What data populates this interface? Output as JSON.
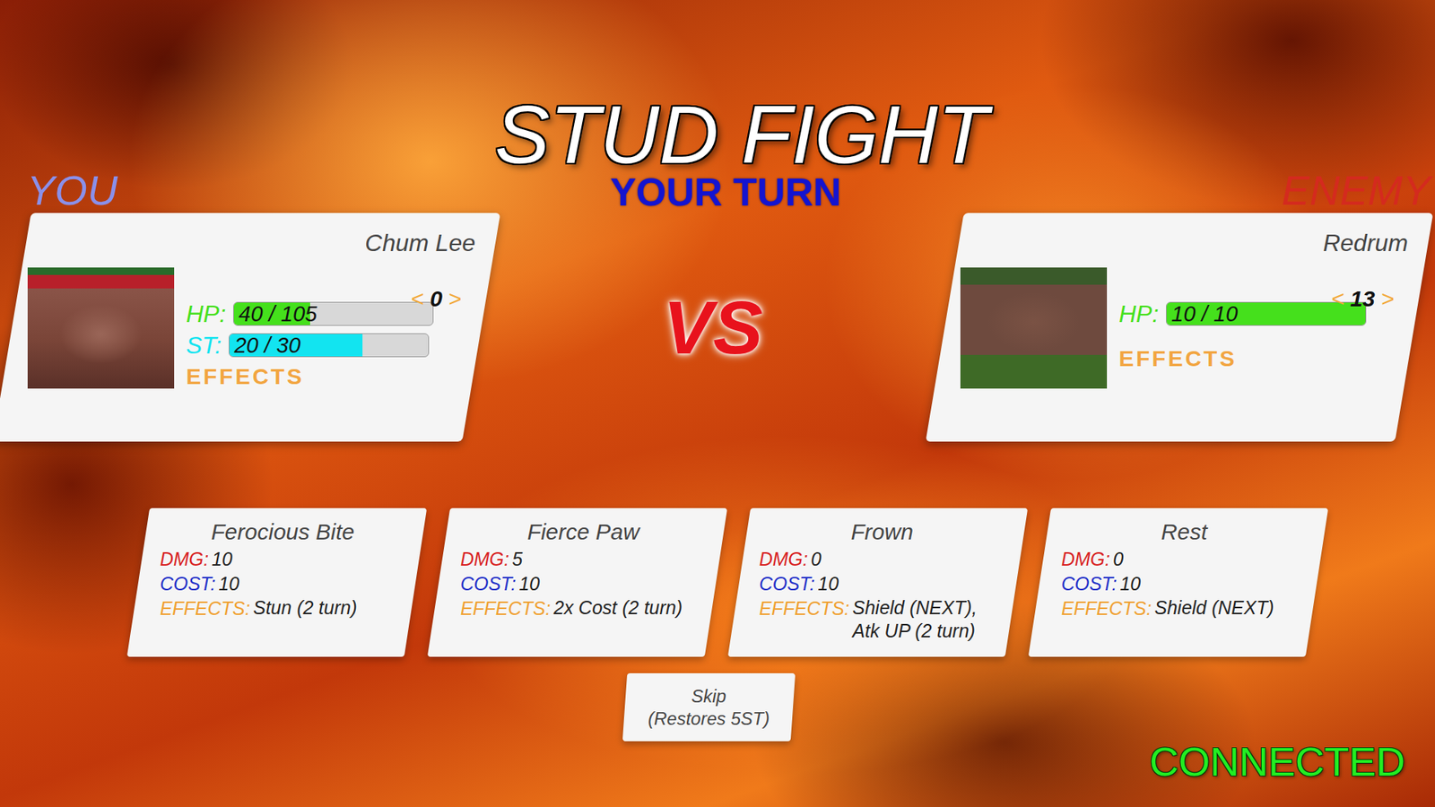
{
  "title": "STUD FIGHT",
  "turn": "YOUR TURN",
  "vs": "VS",
  "fighters": [
    {
      "side_label": "YOU",
      "color": "#8a90ea",
      "name": "Chum Lee",
      "counter": {
        "prev": "<",
        "value": "0",
        "next": ">"
      },
      "stats": [
        {
          "label": "HP:",
          "reading": "40 / 105",
          "level": 0.381,
          "color": "#45e01c"
        },
        {
          "label": "ST:",
          "reading": "20 / 30",
          "level": 0.667,
          "color": "#12e4f0"
        }
      ],
      "effects_label": "EFFECTS"
    },
    {
      "side_label": "ENEMY",
      "color": "#d42a1e",
      "name": "Redrum",
      "counter": {
        "prev": "<",
        "value": "13",
        "next": ">"
      },
      "stats": [
        {
          "label": "HP:",
          "reading": "10 / 10",
          "level": 1,
          "color": "#45e01c"
        }
      ],
      "effects_label": "EFFECTS"
    }
  ],
  "moves": [
    {
      "name": "Ferocious Bite",
      "dmg_label": "DMG:",
      "dmg": "10",
      "cost_label": "COST:",
      "cost": "10",
      "effects_label": "EFFECTS:",
      "effects": [
        "Stun (2 turn)"
      ]
    },
    {
      "name": "Fierce Paw",
      "dmg_label": "DMG:",
      "dmg": "5",
      "cost_label": "COST:",
      "cost": "10",
      "effects_label": "EFFECTS:",
      "effects": [
        "2x Cost (2 turn)"
      ]
    },
    {
      "name": "Frown",
      "dmg_label": "DMG:",
      "dmg": "0",
      "cost_label": "COST:",
      "cost": "10",
      "effects_label": "EFFECTS:",
      "effects": [
        "Shield (NEXT),",
        "Atk UP (2 turn)"
      ]
    },
    {
      "name": "Rest",
      "dmg_label": "DMG:",
      "dmg": "0",
      "cost_label": "COST:",
      "cost": "10",
      "effects_label": "EFFECTS:",
      "effects": [
        "Shield (NEXT)"
      ]
    }
  ],
  "skip": {
    "label": "Skip",
    "note": "(Restores 5ST)"
  },
  "status": "CONNECTED"
}
